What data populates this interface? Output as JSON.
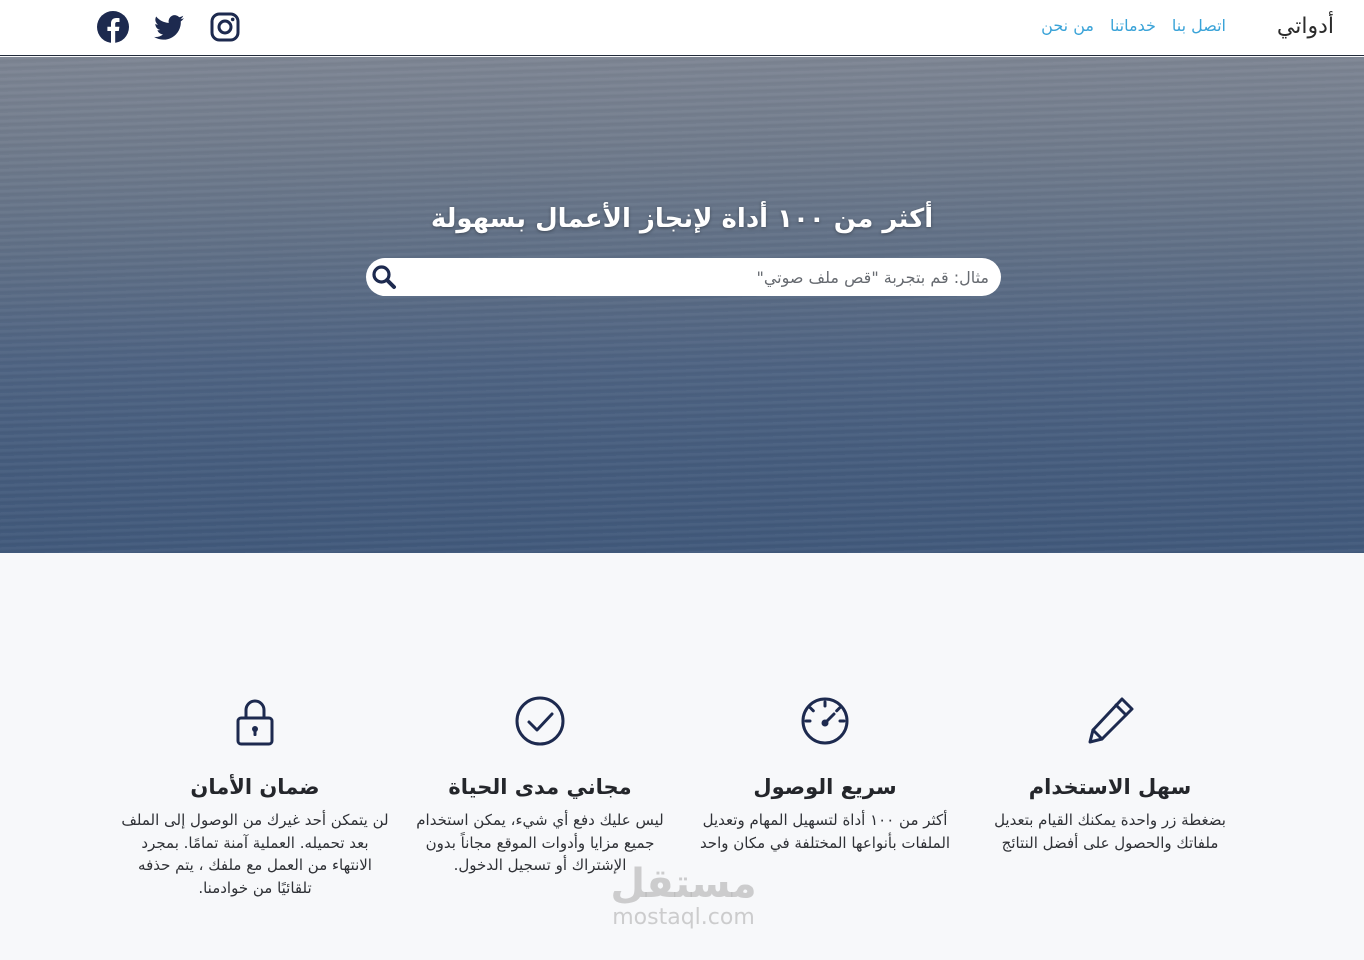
{
  "nav": {
    "brand": "أدواتي",
    "links": [
      {
        "label": "من نحن"
      },
      {
        "label": "خدماتنا"
      },
      {
        "label": "اتصل بنا"
      }
    ],
    "social_icons": [
      "facebook-icon",
      "twitter-icon",
      "instagram-icon"
    ]
  },
  "hero": {
    "title": "أكثر من ١٠٠ أداة لإنجاز الأعمال بسهولة",
    "search_placeholder": "مثال: قم بتجربة \"قص ملف صوتي\"",
    "search_value": ""
  },
  "features": [
    {
      "icon": "pencil-icon",
      "title": "سهل الاستخدام",
      "description": "بضغطة زر واحدة يمكنك القيام بتعديل ملفاتك والحصول على أفضل النتائج"
    },
    {
      "icon": "speedometer-icon",
      "title": "سريع الوصول",
      "description": "أكثر من ١٠٠ أداة لتسهيل المهام وتعديل الملفات بأنواعها المختلفة في مكان واحد"
    },
    {
      "icon": "check-circle-icon",
      "title": "مجاني مدى الحياة",
      "description": "ليس عليك دفع أي شيء، يمكن استخدام جميع مزايا وأدوات الموقع مجاناً بدون الإشتراك أو تسجيل الدخول."
    },
    {
      "icon": "lock-icon",
      "title": "ضمان الأمان",
      "description": "لن يتمكن أحد غيرك من الوصول إلى الملف بعد تحميله. العملية آمنة تمامًا. بمجرد الانتهاء من العمل مع ملفك ، يتم حذفه تلقائيًا من خوادمنا."
    }
  ],
  "watermark": {
    "arabic": "مستقل",
    "latin": "mostaql.com"
  },
  "colors": {
    "accent": "#3aa3d8",
    "icon_navy": "#1d2a4f",
    "hero_top": "#7d8593",
    "hero_bottom": "#41597b"
  }
}
